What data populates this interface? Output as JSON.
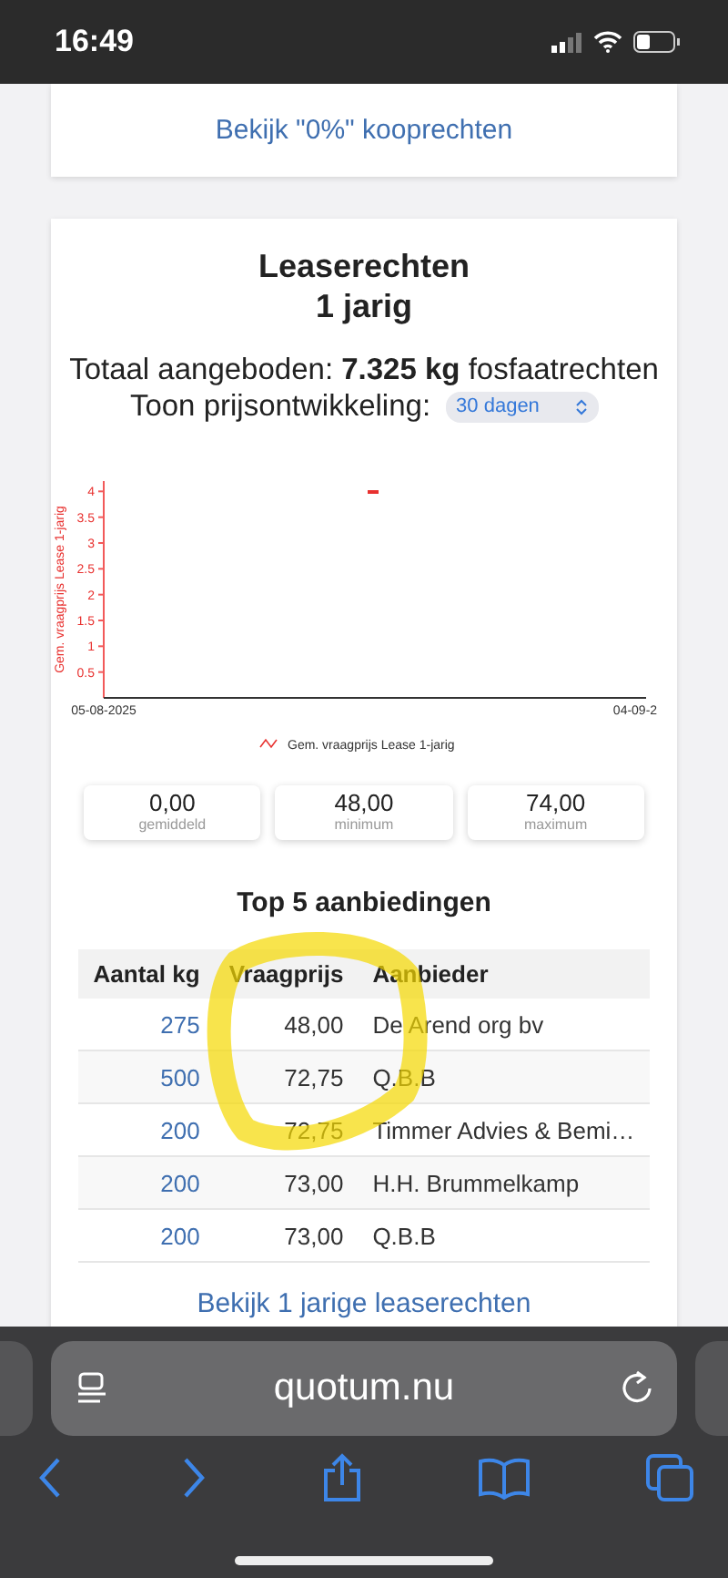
{
  "status_bar": {
    "time": "16:49"
  },
  "top_card": {
    "link": "Bekijk \"0%\" kooprechten"
  },
  "lease_card": {
    "title": "Leaserechten",
    "subtitle": "1 jarig",
    "total": "Totaal aangeboden: **7.325 kg** fosfaatrechten",
    "period_label": "Toon prijsontwikkeling:",
    "period_value": "30 dagen",
    "chart_data": {
      "type": "scatter",
      "ylabel": "Gem. vraagprijs Lease 1-jarig",
      "categories": [
        "05-08-2025",
        null,
        "04-09-2"
      ],
      "yticks": [
        0.5,
        1,
        1.5,
        2,
        2.5,
        3,
        3.5,
        4
      ],
      "ylim": [
        0,
        4.2
      ],
      "series": [
        {
          "name": "Gem. vraagprijs Lease 1-jarig",
          "color": "#e8312f",
          "values": [
            null,
            4,
            null
          ]
        }
      ]
    },
    "stats": [
      {
        "value": "0,00",
        "label": "gemiddeld"
      },
      {
        "value": "48,00",
        "label": "minimum"
      },
      {
        "value": "74,00",
        "label": "maximum"
      }
    ],
    "table_title": "Top 5 aanbiedingen",
    "columns": [
      "Aantal kg",
      "Vraagprijs",
      "Aanbieder"
    ],
    "rows": [
      {
        "kg": "275",
        "price": "48,00",
        "seller": "De Arend org bv"
      },
      {
        "kg": "500",
        "price": "72,75",
        "seller": "Q.B.B"
      },
      {
        "kg": "200",
        "price": "72,75",
        "seller": "Timmer Advies & Bemi…"
      },
      {
        "kg": "200",
        "price": "73,00",
        "seller": "H.H. Brummelkamp"
      },
      {
        "kg": "200",
        "price": "73,00",
        "seller": "Q.B.B"
      }
    ],
    "bottom_link": "Bekijk 1 jarige leaserechten"
  },
  "browser": {
    "url": "quotum.nu"
  }
}
